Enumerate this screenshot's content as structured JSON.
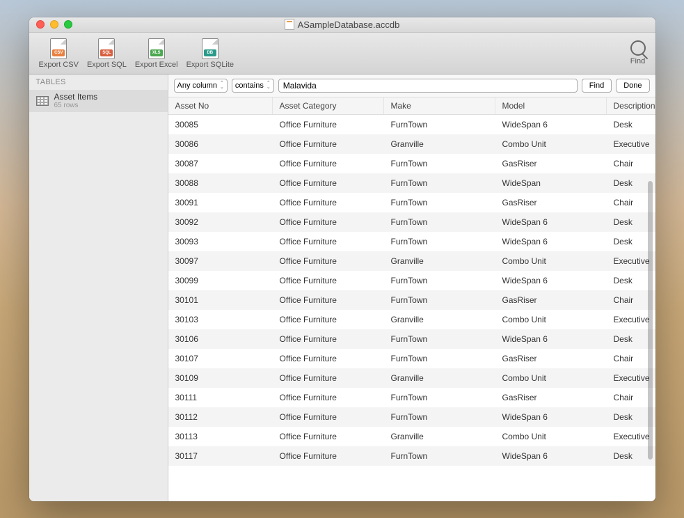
{
  "window": {
    "title": "ASampleDatabase.accdb"
  },
  "toolbar": {
    "export_csv": "Export CSV",
    "export_sql": "Export SQL",
    "export_excel": "Export Excel",
    "export_sqlite": "Export SQLite",
    "find": "Find"
  },
  "sidebar": {
    "header": "TABLES",
    "table": {
      "name": "Asset Items",
      "rows": "65 rows"
    }
  },
  "filter": {
    "column_select": "Any column",
    "condition_select": "contains",
    "search_value": "Malavida",
    "find_btn": "Find",
    "done_btn": "Done"
  },
  "columns": [
    "Asset No",
    "Asset Category",
    "Make",
    "Model",
    "Description"
  ],
  "rows": [
    {
      "no": "30085",
      "cat": "Office Furniture",
      "make": "FurnTown",
      "model": "WideSpan 6",
      "desc": "Desk"
    },
    {
      "no": "30086",
      "cat": "Office Furniture",
      "make": "Granville",
      "model": "Combo Unit",
      "desc": "Executive"
    },
    {
      "no": "30087",
      "cat": "Office Furniture",
      "make": "FurnTown",
      "model": "GasRiser",
      "desc": "Chair"
    },
    {
      "no": "30088",
      "cat": "Office Furniture",
      "make": "FurnTown",
      "model": "WideSpan",
      "desc": "Desk"
    },
    {
      "no": "30091",
      "cat": "Office Furniture",
      "make": "FurnTown",
      "model": "GasRiser",
      "desc": "Chair"
    },
    {
      "no": "30092",
      "cat": "Office Furniture",
      "make": "FurnTown",
      "model": "WideSpan 6",
      "desc": "Desk"
    },
    {
      "no": "30093",
      "cat": "Office Furniture",
      "make": "FurnTown",
      "model": "WideSpan 6",
      "desc": "Desk"
    },
    {
      "no": "30097",
      "cat": "Office Furniture",
      "make": "Granville",
      "model": "Combo Unit",
      "desc": "Executive"
    },
    {
      "no": "30099",
      "cat": "Office Furniture",
      "make": "FurnTown",
      "model": "WideSpan 6",
      "desc": "Desk"
    },
    {
      "no": "30101",
      "cat": "Office Furniture",
      "make": "FurnTown",
      "model": "GasRiser",
      "desc": "Chair"
    },
    {
      "no": "30103",
      "cat": "Office Furniture",
      "make": "Granville",
      "model": "Combo Unit",
      "desc": "Executive"
    },
    {
      "no": "30106",
      "cat": "Office Furniture",
      "make": "FurnTown",
      "model": "WideSpan 6",
      "desc": "Desk"
    },
    {
      "no": "30107",
      "cat": "Office Furniture",
      "make": "FurnTown",
      "model": "GasRiser",
      "desc": "Chair"
    },
    {
      "no": "30109",
      "cat": "Office Furniture",
      "make": "Granville",
      "model": "Combo Unit",
      "desc": "Executive"
    },
    {
      "no": "30111",
      "cat": "Office Furniture",
      "make": "FurnTown",
      "model": "GasRiser",
      "desc": "Chair"
    },
    {
      "no": "30112",
      "cat": "Office Furniture",
      "make": "FurnTown",
      "model": "WideSpan 6",
      "desc": "Desk"
    },
    {
      "no": "30113",
      "cat": "Office Furniture",
      "make": "Granville",
      "model": "Combo Unit",
      "desc": "Executive"
    },
    {
      "no": "30117",
      "cat": "Office Furniture",
      "make": "FurnTown",
      "model": "WideSpan 6",
      "desc": "Desk"
    }
  ]
}
